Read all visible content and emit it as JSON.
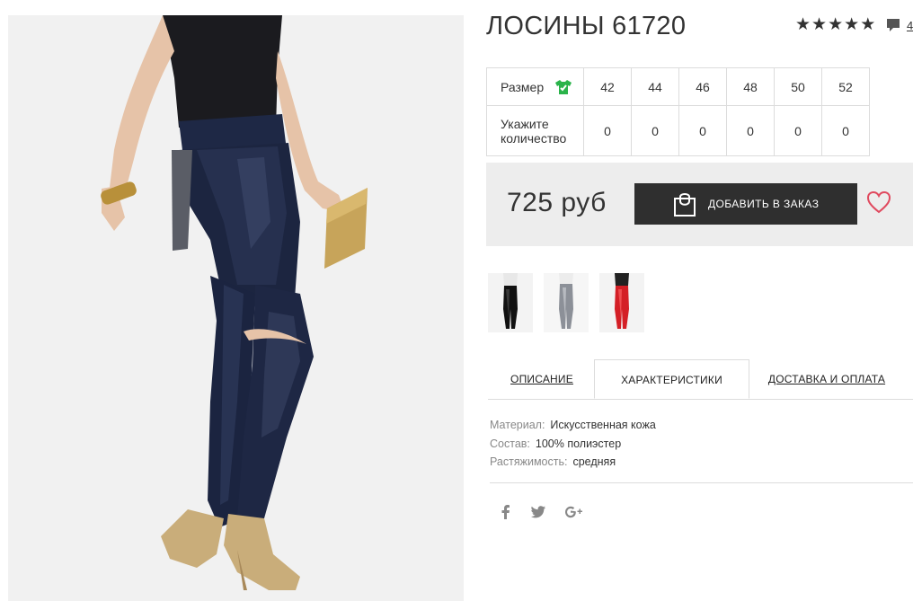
{
  "product": {
    "title": "ЛОСИНЫ 61720",
    "rating_stars": 5,
    "review_count": "4"
  },
  "sizes": {
    "size_label": "Размер",
    "qty_label": "Укажите количество",
    "values": [
      "42",
      "44",
      "46",
      "48",
      "50",
      "52"
    ],
    "quantities": [
      "0",
      "0",
      "0",
      "0",
      "0",
      "0"
    ]
  },
  "purchase": {
    "price": "725 руб",
    "add_button": "ДОБАВИТЬ В ЗАКАЗ"
  },
  "tabs": [
    {
      "label": "ОПИСАНИЕ",
      "active": false
    },
    {
      "label": "ХАРАКТЕРИСТИКИ",
      "active": true
    },
    {
      "label": "ДОСТАВКА И ОПЛАТА",
      "active": false
    }
  ],
  "specs": [
    {
      "key": "Материал:",
      "value": "Искусственная кожа"
    },
    {
      "key": "Состав:",
      "value": "100% полиэстер"
    },
    {
      "key": "Растяжимость:",
      "value": "средняя"
    }
  ],
  "thumbnails": [
    "black-leggings-thumb",
    "grey-leggings-thumb",
    "red-leggings-thumb"
  ],
  "icons": {
    "stars": "star-icon",
    "comments": "comment-icon",
    "size": "tshirt-check-icon",
    "bag": "shopping-bag-icon",
    "wishlist": "heart-icon",
    "social": [
      "facebook-icon",
      "twitter-icon",
      "google-plus-icon"
    ]
  },
  "colors": {
    "dark_button": "#2f2f2f",
    "price_bg": "#ededed",
    "heart": "#e04a5f",
    "size_icon": "#2ab34a",
    "text": "#333333",
    "muted": "#888888"
  }
}
